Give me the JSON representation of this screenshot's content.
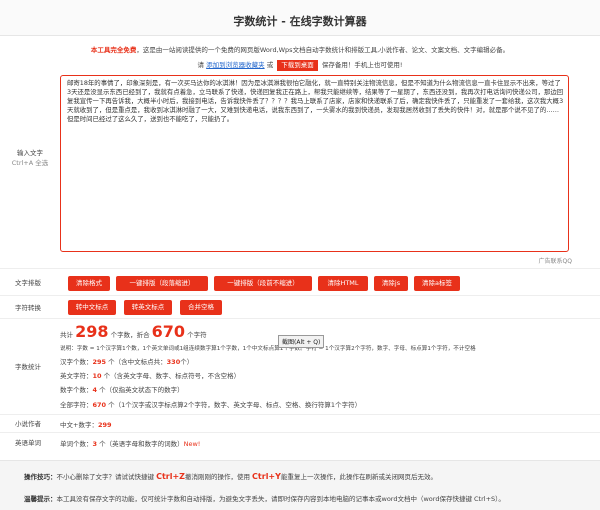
{
  "title": "字数统计 - 在线字数计算器",
  "notice": {
    "free": "本工具完全免费",
    "rest": "，这是由一站阅读提供的一个免费的网页版Word,Wps文档自动字数统计和排版工具,小说作者、论文、文案文档、文字编辑必备。"
  },
  "notice2": {
    "prefix": "请",
    "add_link": "添加到浏览器收藏夹",
    "mid": "或",
    "download": "下载到桌面",
    "suffix": "保存备用！手机上也可使用!"
  },
  "input": {
    "label": "输入文字",
    "hint": "Ctrl+A 全选",
    "text": "邮寄18年的事情了，印象深刻是，有一次买马达你的冰淇淋！因为是冰淇淋我很怕它融化，就一直特别关注物流信息，但是不知道为什么物流信息一直卡住显示不出来，等过了3天还是没显示东西已经到了，我就有点着急，立马联系了快递，快递回复我正在路上，帮我只能继续等，结果等了一星期了，东西还没到，我再次打电话询问快递公司，那边回复我宣传一下再告诉我，大概半小时后，我接到电话，告诉我快件丢了？？？？我马上联系了店家，店家和快递联系了后，确定我快件丢了，只能重发了一套给我，这次我大概3天就收到了，但是重点是，我收到冰淇淋时融了一大，又难到快递电话，说我东西到了，一头雾水的我到快递员，发现我居然收到了丢失的快件！对，就是那个说不见了的……但是时间已经过了这么久了，送到也不能吃了，只能扔了。"
  },
  "qq": "广告联系QQ",
  "format": {
    "label": "文字排版",
    "buttons": [
      "清除格式",
      "一键排版（段落缩进）",
      "一键排版（段前不缩进）",
      "清除HTML",
      "清除js",
      "清除a标签"
    ]
  },
  "convert": {
    "label": "字符转换",
    "buttons": [
      "转中文标点",
      "转英文标点",
      "合并空格"
    ]
  },
  "stats": {
    "label": "字数统计",
    "total_prefix": "共计",
    "words": "298",
    "words_unit": "个字数",
    "sep": "，折合",
    "chars": "670",
    "chars_unit": "个字符",
    "explain": "说明：字数 = 1个汉字算1个数，1个英文单词或1组连续数字算1个字数，1个中文标点算1个字数。字符 = 1个汉字算2个字符，数字、字母、标点算1个字符，不计空格",
    "hanzi_label": "汉字个数：",
    "hanzi": "295",
    "hanzi_note": "个（含中文标点共：",
    "hanzi_with_punct": "330",
    "hanzi_note_end": "个）",
    "en_label": "英文字符：",
    "en": "10",
    "en_note": "个（含英文字母、数字、标点符号，不含空格）",
    "num_label": "数字个数：",
    "num": "4",
    "num_note": "个（仅指英文状态下的数字）",
    "all_label": "全部字符：",
    "all": "670",
    "all_note": "个（1个汉字或汉字标点算2个字符，数字、英文字母、标点、空格、换行符算1个字符）",
    "tooltip": "截图(Alt + Q)"
  },
  "novel": {
    "label": "小说作者",
    "prefix": "中文+数字：",
    "value": "299"
  },
  "english": {
    "label": "英语单词",
    "prefix": "单词个数：",
    "value": "3",
    "note": "个（英语字母和数字的词数）",
    "new": "New!"
  },
  "tips": {
    "t1_label": "操作技巧：",
    "t1_a": "不小心删除了文字？请试试快捷键",
    "t1_key1": "Ctrl+Z",
    "t1_b": "撤消刚刚的操作，使用",
    "t1_key2": "Ctrl+Y",
    "t1_c": "能重复上一次操作，此操作在刷新或关闭网页后无效。",
    "t2_label": "温馨提示：",
    "t2": "本工具没有保存文字的功能，仅可统计字数和自动排版，为避免文字丢失，请即时保存内容到本地电脑的记事本或word文档中（word保存快捷键 Ctrl+S）。"
  }
}
